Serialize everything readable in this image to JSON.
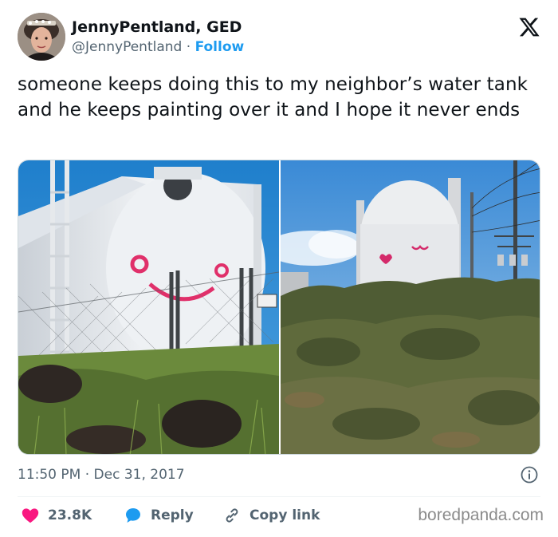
{
  "author": {
    "display_name": "JennyPentland, GED",
    "handle": "@JennyPentland",
    "separator": "·",
    "follow_label": "Follow"
  },
  "tweet": {
    "text": "someone keeps doing this to my neighbor’s water tank and he keeps painting over it and I hope it never ends",
    "timestamp": "11:50 PM · Dec 31, 2017"
  },
  "actions": {
    "likes_count": "23.8K",
    "reply_label": "Reply",
    "copy_link_label": "Copy link"
  },
  "watermark": "boredpanda.com",
  "colors": {
    "text_primary": "#0f1419",
    "text_secondary": "#536471",
    "link_blue": "#1d9bf0",
    "like_red": "#f91880",
    "divider": "#eff3f4"
  },
  "icons": [
    "x-logo-icon",
    "info-icon",
    "heart-icon",
    "reply-bubble-icon",
    "link-icon"
  ]
}
